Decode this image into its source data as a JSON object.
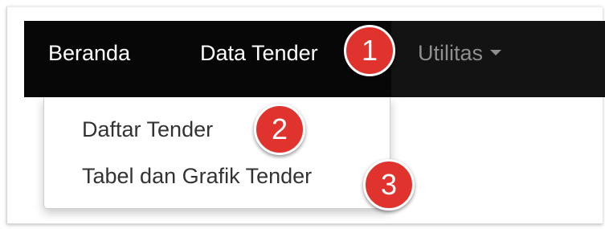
{
  "navbar": {
    "items": [
      {
        "label": "Beranda"
      },
      {
        "label": "Data Tender"
      },
      {
        "label": "Utilitas"
      }
    ]
  },
  "dropdown": {
    "items": [
      {
        "label": "Daftar Tender"
      },
      {
        "label": "Tabel dan Grafik Tender"
      }
    ]
  },
  "annotations": [
    "1",
    "2",
    "3"
  ],
  "colors": {
    "navbar_bg": "#070707",
    "nav_text": "#ffffff",
    "nav_muted": "#8e8e8e",
    "badge": "#e0332e",
    "dropdown_text": "#333333"
  },
  "icons": {
    "dropdown_caret": "caret-down-icon"
  }
}
